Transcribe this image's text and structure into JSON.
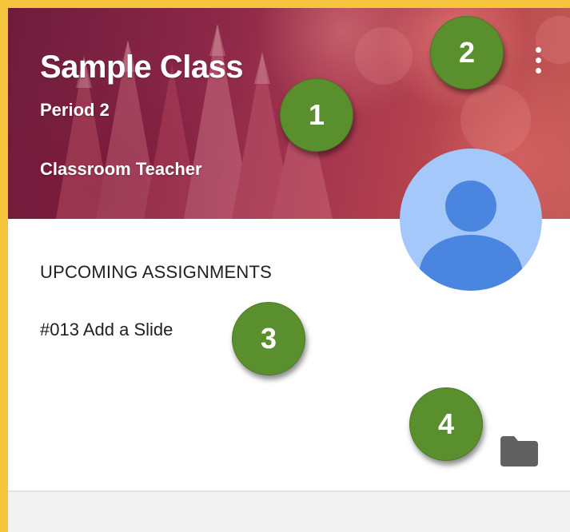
{
  "class_card": {
    "title": "Sample Class",
    "period": "Period 2",
    "teacher": "Classroom Teacher",
    "more_menu_icon": "more-vert-icon",
    "avatar_icon": "person-icon",
    "upcoming_label": "UPCOMING ASSIGNMENTS",
    "assignment": "#013 Add a Slide",
    "folder_icon": "folder-icon"
  },
  "markers": [
    "1",
    "2",
    "3",
    "4"
  ],
  "colors": {
    "page_border": "#f5c43c",
    "marker_green": "#5a8f2e",
    "avatar_bg": "#a5c8fb",
    "avatar_person": "#4a86e0",
    "folder_gray": "#616161"
  }
}
